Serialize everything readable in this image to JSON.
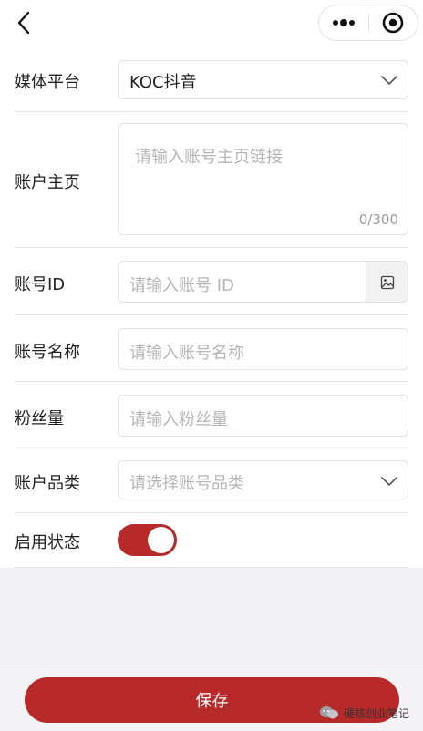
{
  "topbar": {
    "back_icon": "chevron-left-icon",
    "more_icon": "more-dots-icon",
    "target_icon": "target-circle-icon"
  },
  "form": {
    "platform": {
      "label": "媒体平台",
      "value": "KOC抖音"
    },
    "homepage": {
      "label": "账户主页",
      "placeholder": "请输入账号主页链接",
      "counter": "0/300"
    },
    "account_id": {
      "label": "账号ID",
      "placeholder": "请输入账号 ID"
    },
    "account_name": {
      "label": "账号名称",
      "placeholder": "请输入账号名称"
    },
    "fans": {
      "label": "粉丝量",
      "placeholder": "请输入粉丝量"
    },
    "category": {
      "label": "账户品类",
      "placeholder": "请选择账号品类"
    },
    "status": {
      "label": "启用状态",
      "enabled": true
    }
  },
  "footer": {
    "save_label": "保存"
  },
  "watermark": {
    "text": "硬核创业笔记"
  },
  "colors": {
    "accent": "#b82a2a",
    "placeholder": "#b5b5b5",
    "border": "#e2e2e2",
    "background_gray": "#f2f2f4"
  }
}
